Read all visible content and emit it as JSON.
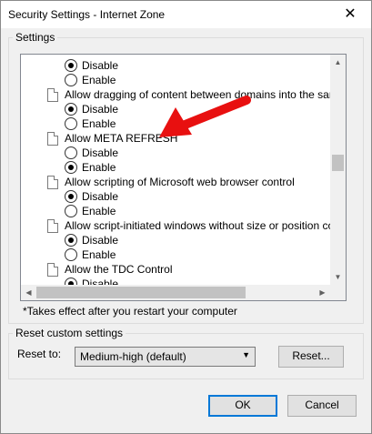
{
  "window": {
    "title": "Security Settings - Internet Zone",
    "close_glyph": "✕"
  },
  "settings_group": {
    "label": "Settings",
    "rows": [
      {
        "type": "radio",
        "label": "Disable",
        "checked": true
      },
      {
        "type": "radio",
        "label": "Enable",
        "checked": false
      },
      {
        "type": "item",
        "label": "Allow dragging of content between domains into the same wi"
      },
      {
        "type": "radio",
        "label": "Disable",
        "checked": true
      },
      {
        "type": "radio",
        "label": "Enable",
        "checked": false
      },
      {
        "type": "item",
        "label": "Allow META REFRESH"
      },
      {
        "type": "radio",
        "label": "Disable",
        "checked": false
      },
      {
        "type": "radio",
        "label": "Enable",
        "checked": true
      },
      {
        "type": "item",
        "label": "Allow scripting of Microsoft web browser control"
      },
      {
        "type": "radio",
        "label": "Disable",
        "checked": true
      },
      {
        "type": "radio",
        "label": "Enable",
        "checked": false
      },
      {
        "type": "item",
        "label": "Allow script-initiated windows without size or position constra"
      },
      {
        "type": "radio",
        "label": "Disable",
        "checked": true
      },
      {
        "type": "radio",
        "label": "Enable",
        "checked": false
      },
      {
        "type": "item",
        "label": "Allow the TDC Control"
      },
      {
        "type": "radio",
        "label": "Disable",
        "checked": true
      }
    ],
    "restart_note": "*Takes effect after you restart your computer"
  },
  "reset_group": {
    "label": "Reset custom settings",
    "reset_to_label": "Reset to:",
    "selected": "Medium-high (default)",
    "reset_button": "Reset..."
  },
  "buttons": {
    "ok": "OK",
    "cancel": "Cancel"
  },
  "annotation": {
    "arrow_color": "#e81010"
  },
  "scroll_arrows": {
    "up": "▲",
    "down": "▼",
    "left": "◀",
    "right": "▶",
    "dropdown": "▼"
  }
}
